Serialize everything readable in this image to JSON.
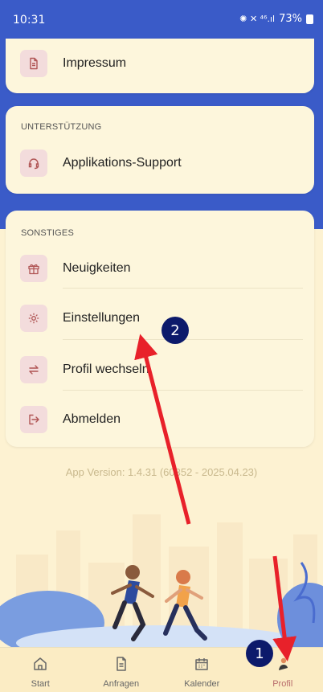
{
  "status_bar": {
    "time": "10:31",
    "indicators": "✺ ✕ ⁴⁶.ıl",
    "battery_percent": "73%"
  },
  "sections": {
    "top": {
      "items": [
        {
          "label": "Impressum",
          "icon": "document-icon"
        }
      ]
    },
    "support": {
      "title": "UNTERSTÜTZUNG",
      "items": [
        {
          "label": "Applikations-Support",
          "icon": "headset-icon"
        }
      ]
    },
    "misc": {
      "title": "SONSTIGES",
      "items": [
        {
          "label": "Neuigkeiten",
          "icon": "gift-icon"
        },
        {
          "label": "Einstellungen",
          "icon": "gear-icon"
        },
        {
          "label": "Profil wechseln",
          "icon": "swap-icon"
        },
        {
          "label": "Abmelden",
          "icon": "logout-icon"
        }
      ]
    }
  },
  "app_version": "App Version: 1.4.31 (60352 - 2025.04.23)",
  "bottom_nav": {
    "items": [
      {
        "label": "Start",
        "icon": "home-icon"
      },
      {
        "label": "Anfragen",
        "icon": "requests-icon"
      },
      {
        "label": "Kalender",
        "icon": "calendar-icon"
      },
      {
        "label": "Profil",
        "icon": "profile-icon",
        "active": true
      }
    ]
  },
  "annotations": {
    "step1": "1",
    "step2": "2"
  },
  "colors": {
    "header_blue": "#3a5bc8",
    "card_bg": "#fdf6dc",
    "icon_bg": "#f3dcdc",
    "icon_stroke": "#b05555",
    "arrow_red": "#e8212a",
    "badge_navy": "#0c1a6b"
  }
}
